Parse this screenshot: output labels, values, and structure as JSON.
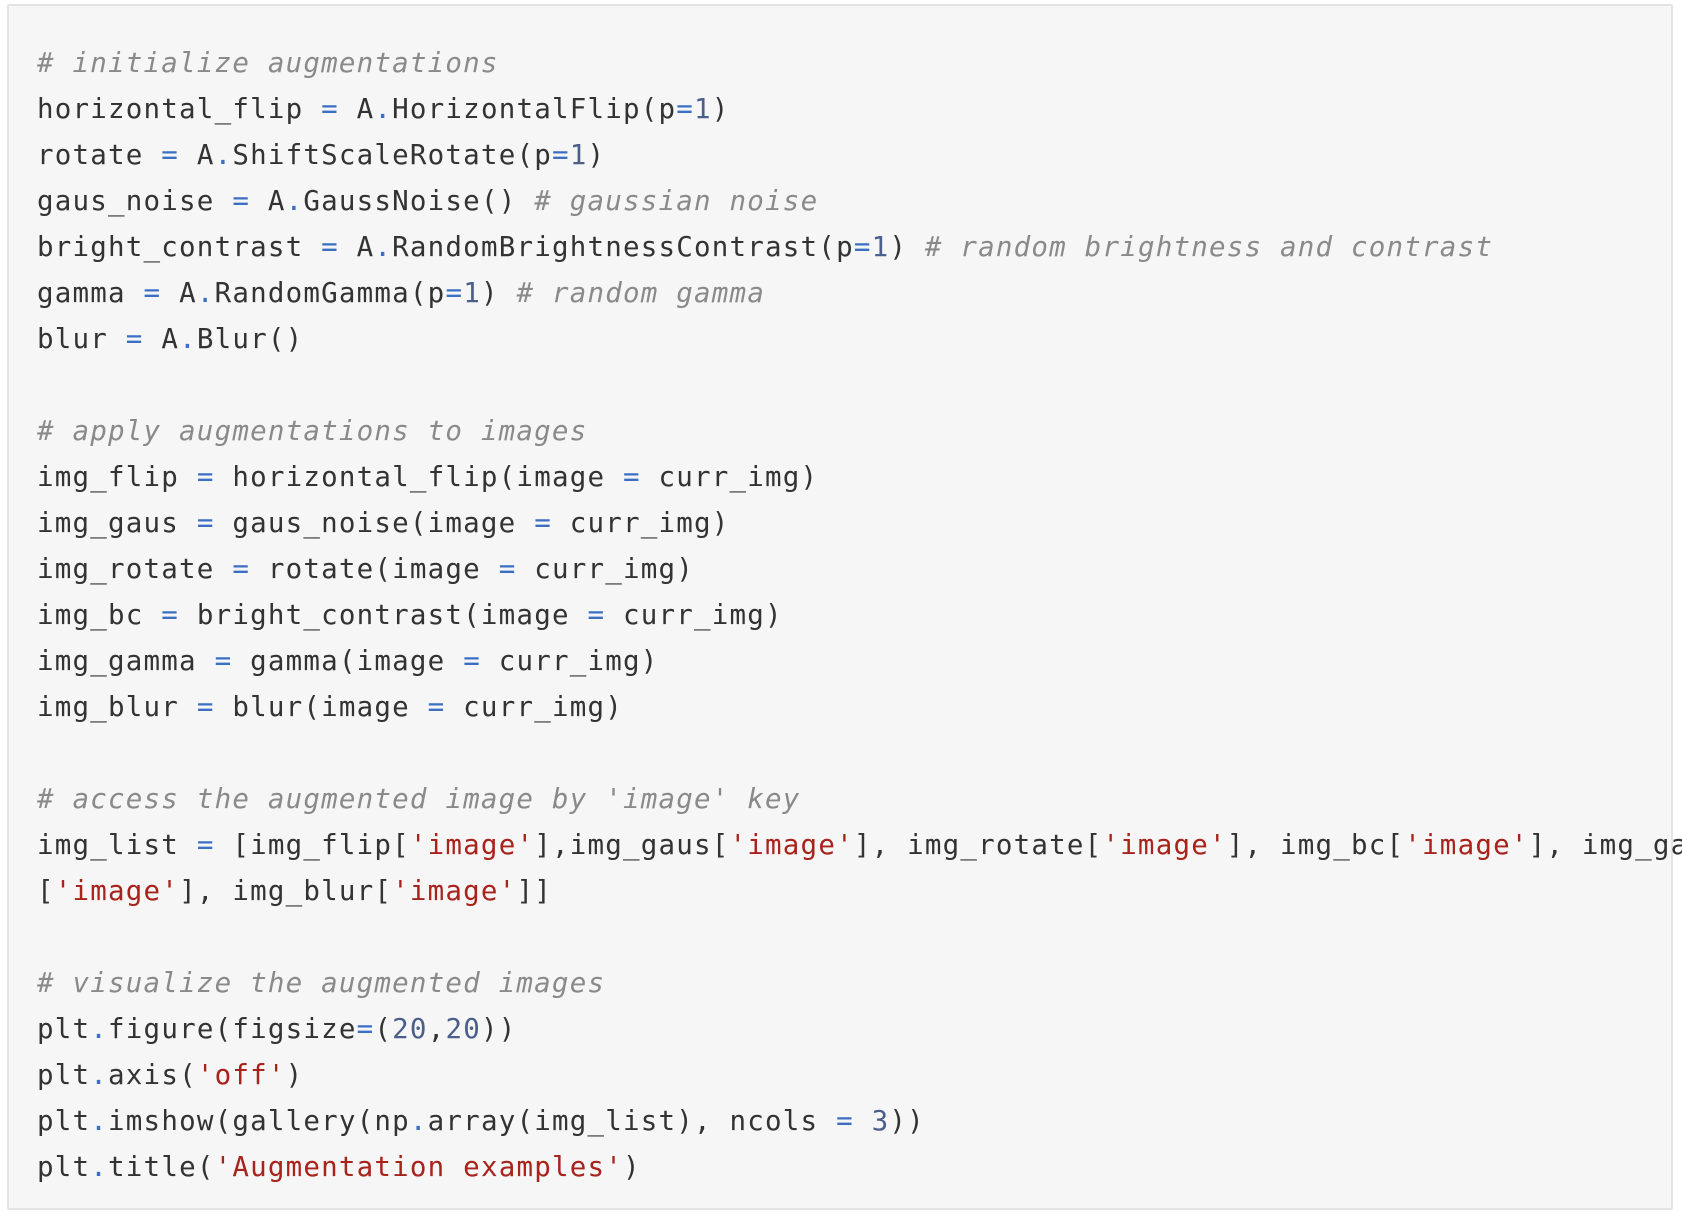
{
  "colors": {
    "background": "#f6f6f6",
    "text": "#333333",
    "comment": "#8a8a8a",
    "operator": "#3a6fc4",
    "number": "#4a5f8a",
    "string": "#a8231b"
  },
  "code": {
    "language": "python",
    "lines": [
      [
        {
          "t": "c",
          "v": "# initialize augmentations"
        }
      ],
      [
        {
          "t": "p",
          "v": "horizontal_flip "
        },
        {
          "t": "o",
          "v": "="
        },
        {
          "t": "p",
          "v": " A"
        },
        {
          "t": "o",
          "v": "."
        },
        {
          "t": "p",
          "v": "HorizontalFlip(p"
        },
        {
          "t": "o",
          "v": "="
        },
        {
          "t": "n",
          "v": "1"
        },
        {
          "t": "p",
          "v": ")"
        }
      ],
      [
        {
          "t": "p",
          "v": "rotate "
        },
        {
          "t": "o",
          "v": "="
        },
        {
          "t": "p",
          "v": " A"
        },
        {
          "t": "o",
          "v": "."
        },
        {
          "t": "p",
          "v": "ShiftScaleRotate(p"
        },
        {
          "t": "o",
          "v": "="
        },
        {
          "t": "n",
          "v": "1"
        },
        {
          "t": "p",
          "v": ")"
        }
      ],
      [
        {
          "t": "p",
          "v": "gaus_noise "
        },
        {
          "t": "o",
          "v": "="
        },
        {
          "t": "p",
          "v": " A"
        },
        {
          "t": "o",
          "v": "."
        },
        {
          "t": "p",
          "v": "GaussNoise() "
        },
        {
          "t": "c",
          "v": "# gaussian noise"
        }
      ],
      [
        {
          "t": "p",
          "v": "bright_contrast "
        },
        {
          "t": "o",
          "v": "="
        },
        {
          "t": "p",
          "v": " A"
        },
        {
          "t": "o",
          "v": "."
        },
        {
          "t": "p",
          "v": "RandomBrightnessContrast(p"
        },
        {
          "t": "o",
          "v": "="
        },
        {
          "t": "n",
          "v": "1"
        },
        {
          "t": "p",
          "v": ") "
        },
        {
          "t": "c",
          "v": "# random brightness and contrast"
        }
      ],
      [
        {
          "t": "p",
          "v": "gamma "
        },
        {
          "t": "o",
          "v": "="
        },
        {
          "t": "p",
          "v": " A"
        },
        {
          "t": "o",
          "v": "."
        },
        {
          "t": "p",
          "v": "RandomGamma(p"
        },
        {
          "t": "o",
          "v": "="
        },
        {
          "t": "n",
          "v": "1"
        },
        {
          "t": "p",
          "v": ") "
        },
        {
          "t": "c",
          "v": "# random gamma"
        }
      ],
      [
        {
          "t": "p",
          "v": "blur "
        },
        {
          "t": "o",
          "v": "="
        },
        {
          "t": "p",
          "v": " A"
        },
        {
          "t": "o",
          "v": "."
        },
        {
          "t": "p",
          "v": "Blur()"
        }
      ],
      [],
      [
        {
          "t": "c",
          "v": "# apply augmentations to images"
        }
      ],
      [
        {
          "t": "p",
          "v": "img_flip "
        },
        {
          "t": "o",
          "v": "="
        },
        {
          "t": "p",
          "v": " horizontal_flip(image "
        },
        {
          "t": "o",
          "v": "="
        },
        {
          "t": "p",
          "v": " curr_img)"
        }
      ],
      [
        {
          "t": "p",
          "v": "img_gaus "
        },
        {
          "t": "o",
          "v": "="
        },
        {
          "t": "p",
          "v": " gaus_noise(image "
        },
        {
          "t": "o",
          "v": "="
        },
        {
          "t": "p",
          "v": " curr_img)"
        }
      ],
      [
        {
          "t": "p",
          "v": "img_rotate "
        },
        {
          "t": "o",
          "v": "="
        },
        {
          "t": "p",
          "v": " rotate(image "
        },
        {
          "t": "o",
          "v": "="
        },
        {
          "t": "p",
          "v": " curr_img)"
        }
      ],
      [
        {
          "t": "p",
          "v": "img_bc "
        },
        {
          "t": "o",
          "v": "="
        },
        {
          "t": "p",
          "v": " bright_contrast(image "
        },
        {
          "t": "o",
          "v": "="
        },
        {
          "t": "p",
          "v": " curr_img)"
        }
      ],
      [
        {
          "t": "p",
          "v": "img_gamma "
        },
        {
          "t": "o",
          "v": "="
        },
        {
          "t": "p",
          "v": " gamma(image "
        },
        {
          "t": "o",
          "v": "="
        },
        {
          "t": "p",
          "v": " curr_img)"
        }
      ],
      [
        {
          "t": "p",
          "v": "img_blur "
        },
        {
          "t": "o",
          "v": "="
        },
        {
          "t": "p",
          "v": " blur(image "
        },
        {
          "t": "o",
          "v": "="
        },
        {
          "t": "p",
          "v": " curr_img)"
        }
      ],
      [],
      [
        {
          "t": "c",
          "v": "# access the augmented image by 'image' key"
        }
      ],
      [
        {
          "t": "p",
          "v": "img_list "
        },
        {
          "t": "o",
          "v": "="
        },
        {
          "t": "p",
          "v": " [img_flip["
        },
        {
          "t": "s",
          "v": "'image'"
        },
        {
          "t": "p",
          "v": "],img_gaus["
        },
        {
          "t": "s",
          "v": "'image'"
        },
        {
          "t": "p",
          "v": "], img_rotate["
        },
        {
          "t": "s",
          "v": "'image'"
        },
        {
          "t": "p",
          "v": "], img_bc["
        },
        {
          "t": "s",
          "v": "'image'"
        },
        {
          "t": "p",
          "v": "], img_gamma"
        }
      ],
      [
        {
          "t": "p",
          "v": "["
        },
        {
          "t": "s",
          "v": "'image'"
        },
        {
          "t": "p",
          "v": "], img_blur["
        },
        {
          "t": "s",
          "v": "'image'"
        },
        {
          "t": "p",
          "v": "]]"
        }
      ],
      [],
      [
        {
          "t": "c",
          "v": "# visualize the augmented images"
        }
      ],
      [
        {
          "t": "p",
          "v": "plt"
        },
        {
          "t": "o",
          "v": "."
        },
        {
          "t": "p",
          "v": "figure(figsize"
        },
        {
          "t": "o",
          "v": "="
        },
        {
          "t": "p",
          "v": "("
        },
        {
          "t": "n",
          "v": "20"
        },
        {
          "t": "p",
          "v": ","
        },
        {
          "t": "n",
          "v": "20"
        },
        {
          "t": "p",
          "v": "))"
        }
      ],
      [
        {
          "t": "p",
          "v": "plt"
        },
        {
          "t": "o",
          "v": "."
        },
        {
          "t": "p",
          "v": "axis("
        },
        {
          "t": "s",
          "v": "'off'"
        },
        {
          "t": "p",
          "v": ")"
        }
      ],
      [
        {
          "t": "p",
          "v": "plt"
        },
        {
          "t": "o",
          "v": "."
        },
        {
          "t": "p",
          "v": "imshow(gallery(np"
        },
        {
          "t": "o",
          "v": "."
        },
        {
          "t": "p",
          "v": "array(img_list), ncols "
        },
        {
          "t": "o",
          "v": "="
        },
        {
          "t": "p",
          "v": " "
        },
        {
          "t": "n",
          "v": "3"
        },
        {
          "t": "p",
          "v": "))"
        }
      ],
      [
        {
          "t": "p",
          "v": "plt"
        },
        {
          "t": "o",
          "v": "."
        },
        {
          "t": "p",
          "v": "title("
        },
        {
          "t": "s",
          "v": "'Augmentation examples'"
        },
        {
          "t": "p",
          "v": ")"
        }
      ]
    ]
  }
}
